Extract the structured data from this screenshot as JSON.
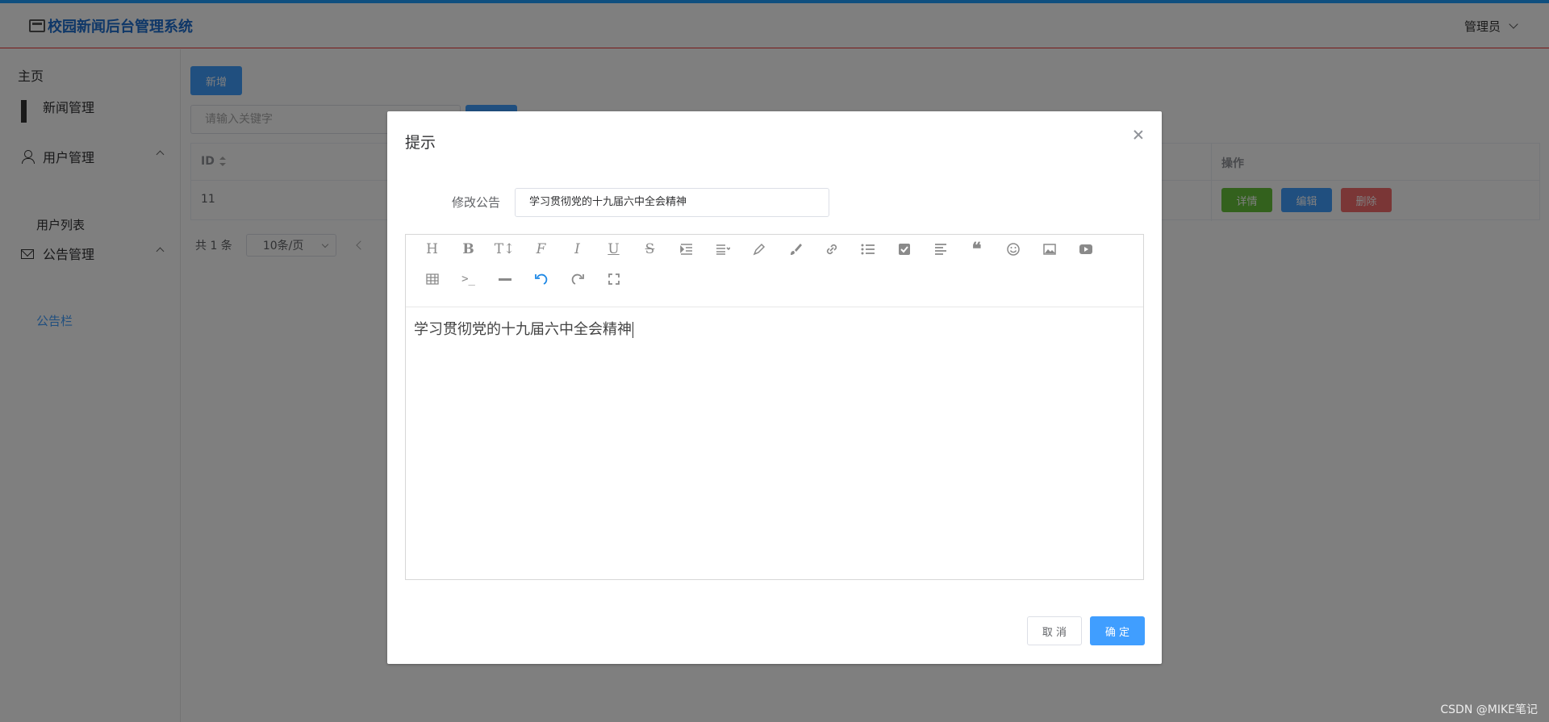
{
  "colors": {
    "accent": "#409eff",
    "header_line": "#ee3333",
    "success": "#67c23a",
    "danger": "#f56c6c"
  },
  "header": {
    "app_title": "校园新闻后台管理系统",
    "user_label": "管理员"
  },
  "sidebar": {
    "home": "主页",
    "items": [
      {
        "label": "新闻管理",
        "icon": "grid-icon"
      },
      {
        "label": "用户管理",
        "icon": "user-icon"
      },
      {
        "label": "公告管理",
        "icon": "mail-icon"
      }
    ],
    "sub_user": "用户列表",
    "sub_notice": "公告栏"
  },
  "main": {
    "add_label": "新增",
    "search_placeholder": "请输入关键字",
    "table": {
      "col_id": "ID",
      "col_op": "操作",
      "rows": [
        {
          "id": "11"
        }
      ],
      "btn_detail": "详情",
      "btn_edit": "编辑",
      "btn_delete": "删除"
    },
    "pager": {
      "total": "共 1 条",
      "page_size": "10条/页"
    }
  },
  "dialog": {
    "title": "提示",
    "field_label": "修改公告",
    "field_value": "学习贯彻党的十九届六中全会精神",
    "editor_content": "学习贯彻党的十九届六中全会精神",
    "toolbar_row1": [
      "heading-icon",
      "bold-icon",
      "font-size-icon",
      "font-style-icon",
      "italic-icon",
      "underline-icon",
      "strikethrough-icon",
      "indent-icon",
      "line-height-icon",
      "color-icon",
      "background-icon",
      "link-icon",
      "list-icon",
      "checkbox-icon",
      "align-icon",
      "quote-icon",
      "emoji-icon",
      "image-icon",
      "video-icon"
    ],
    "toolbar_row2": [
      "table-icon",
      "code-icon",
      "divider-icon",
      "undo-icon",
      "redo-icon",
      "fullscreen-icon"
    ],
    "cancel_label": "取 消",
    "ok_label": "确 定"
  },
  "watermark": "CSDN @MIKE笔记"
}
